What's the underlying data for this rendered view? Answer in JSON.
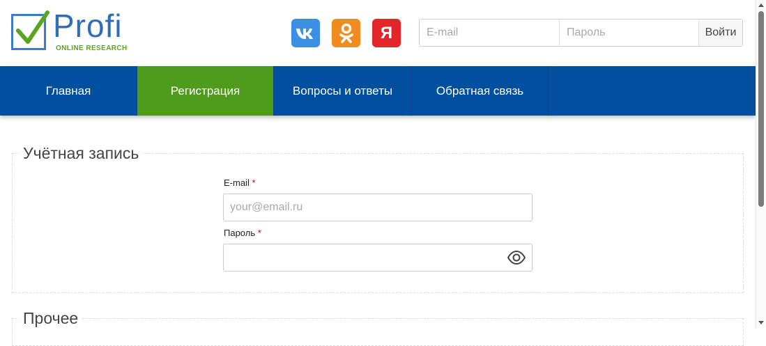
{
  "logo": {
    "name": "Profi",
    "subtitle": "ONLINE RESEARCH"
  },
  "social": [
    {
      "name": "vk",
      "icon": "vk-icon",
      "color": "#3c8fe3"
    },
    {
      "name": "odnoklassniki",
      "icon": "ok-icon",
      "color": "#f28a20"
    },
    {
      "name": "yandex",
      "icon": "yandex-icon",
      "label": "Я",
      "color": "#e3262b"
    }
  ],
  "login": {
    "email_placeholder": "E-mail",
    "password_placeholder": "Пароль",
    "submit_label": "Войти"
  },
  "nav": {
    "items": [
      {
        "label": "Главная",
        "active": false
      },
      {
        "label": "Регистрация",
        "active": true
      },
      {
        "label": "Вопросы и ответы",
        "active": false
      },
      {
        "label": "Обратная связь",
        "active": false
      }
    ]
  },
  "account": {
    "legend": "Учётная запись",
    "email_label": "E-mail",
    "email_placeholder": "your@email.ru",
    "password_label": "Пароль",
    "required_mark": "*",
    "eye_icon": "eye-icon"
  },
  "other": {
    "legend": "Прочее"
  },
  "colors": {
    "nav_bg": "#0150a0",
    "nav_active": "#4f9b1b",
    "brand_blue": "#2f6fb6",
    "brand_green": "#5aa51f",
    "required": "#c0000c"
  }
}
